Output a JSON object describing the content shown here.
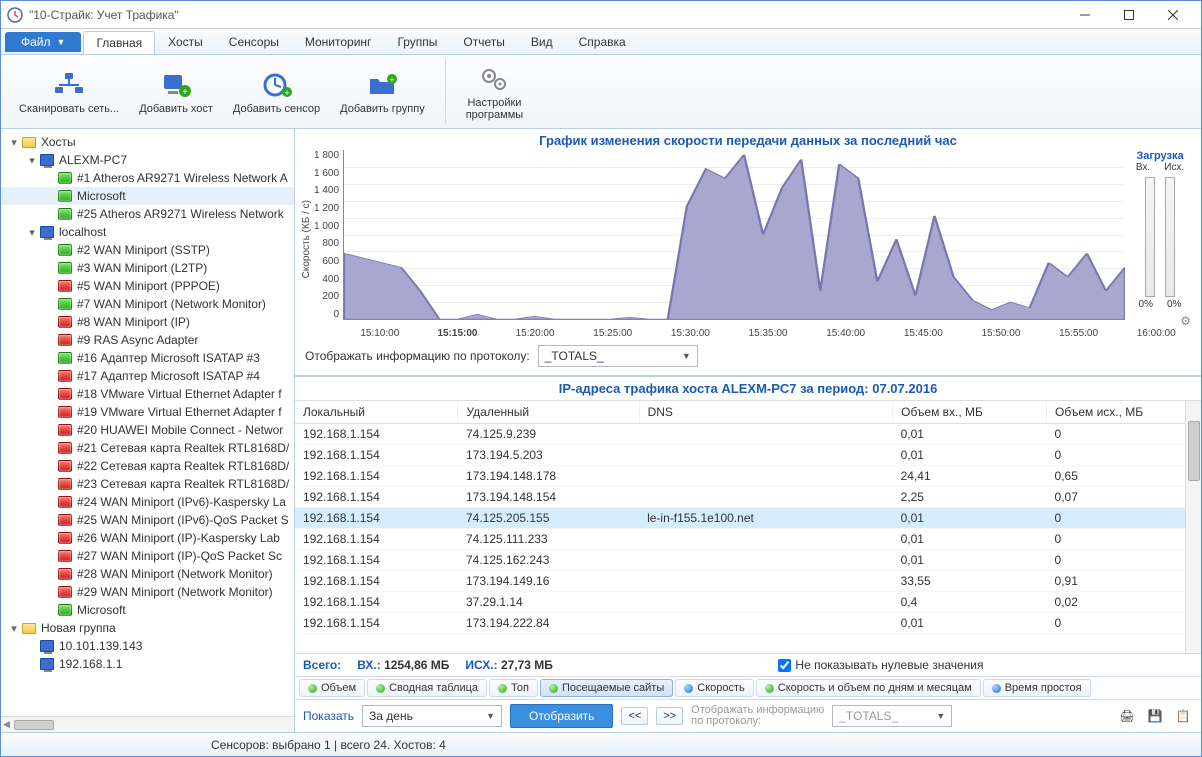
{
  "window": {
    "title": "\"10-Страйк: Учет Трафика\""
  },
  "menubar": {
    "file": "Файл",
    "tabs": [
      "Главная",
      "Хосты",
      "Сенсоры",
      "Мониторинг",
      "Группы",
      "Отчеты",
      "Вид",
      "Справка"
    ],
    "active": 0
  },
  "ribbon": {
    "g1": [
      {
        "label": "Сканировать сеть...",
        "icon": "scan-network-icon"
      },
      {
        "label": "Добавить хост",
        "icon": "add-host-icon"
      },
      {
        "label": "Добавить сенсор",
        "icon": "add-sensor-icon"
      },
      {
        "label": "Добавить группу",
        "icon": "add-group-icon"
      }
    ],
    "g2": [
      {
        "label": "Настройки\nпрограммы",
        "icon": "settings-icon"
      }
    ]
  },
  "tree": [
    {
      "d": 0,
      "exp": "▾",
      "icon": "folder",
      "label": "Хосты"
    },
    {
      "d": 1,
      "exp": "▾",
      "icon": "pc",
      "label": "ALEXM-PC7"
    },
    {
      "d": 2,
      "icon": "g",
      "label": "#1 Atheros AR9271 Wireless Network A"
    },
    {
      "d": 2,
      "icon": "g",
      "label": "Microsoft",
      "sel": true
    },
    {
      "d": 2,
      "icon": "g",
      "label": "#25 Atheros AR9271 Wireless Network"
    },
    {
      "d": 1,
      "exp": "▾",
      "icon": "pc",
      "label": "localhost"
    },
    {
      "d": 2,
      "icon": "g",
      "label": "#2 WAN Miniport (SSTP)"
    },
    {
      "d": 2,
      "icon": "g",
      "label": "#3 WAN Miniport (L2TP)"
    },
    {
      "d": 2,
      "icon": "r",
      "label": "#5 WAN Miniport (PPPOE)"
    },
    {
      "d": 2,
      "icon": "g",
      "label": "#7 WAN Miniport (Network Monitor)"
    },
    {
      "d": 2,
      "icon": "r",
      "label": "#8 WAN Miniport (IP)"
    },
    {
      "d": 2,
      "icon": "r",
      "label": "#9 RAS Async Adapter"
    },
    {
      "d": 2,
      "icon": "g",
      "label": "#16 Адаптер Microsoft ISATAP #3"
    },
    {
      "d": 2,
      "icon": "r",
      "label": "#17 Адаптер Microsoft ISATAP #4"
    },
    {
      "d": 2,
      "icon": "r",
      "label": "#18 VMware Virtual Ethernet Adapter f"
    },
    {
      "d": 2,
      "icon": "r",
      "label": "#19 VMware Virtual Ethernet Adapter f"
    },
    {
      "d": 2,
      "icon": "r",
      "label": "#20 HUAWEI Mobile Connect - Networ"
    },
    {
      "d": 2,
      "icon": "r",
      "label": "#21 Сетевая карта Realtek RTL8168D/"
    },
    {
      "d": 2,
      "icon": "r",
      "label": "#22 Сетевая карта Realtek RTL8168D/"
    },
    {
      "d": 2,
      "icon": "r",
      "label": "#23 Сетевая карта Realtek RTL8168D/"
    },
    {
      "d": 2,
      "icon": "r",
      "label": "#24 WAN Miniport (IPv6)-Kaspersky La"
    },
    {
      "d": 2,
      "icon": "r",
      "label": "#25 WAN Miniport (IPv6)-QoS Packet S"
    },
    {
      "d": 2,
      "icon": "r",
      "label": "#26 WAN Miniport (IP)-Kaspersky Lab"
    },
    {
      "d": 2,
      "icon": "r",
      "label": "#27 WAN Miniport (IP)-QoS Packet Sc"
    },
    {
      "d": 2,
      "icon": "r",
      "label": "#28 WAN Miniport (Network Monitor)"
    },
    {
      "d": 2,
      "icon": "r",
      "label": "#29 WAN Miniport (Network Monitor)"
    },
    {
      "d": 2,
      "icon": "g",
      "label": "Microsoft"
    },
    {
      "d": 0,
      "exp": "▾",
      "icon": "folder",
      "label": "Новая группа"
    },
    {
      "d": 1,
      "icon": "pc",
      "label": "10.101.139.143"
    },
    {
      "d": 1,
      "icon": "pc",
      "label": "192.168.1.1"
    }
  ],
  "chart": {
    "title": "График изменения скорости передачи данных за последний час",
    "ylabel": "Скорость (КБ / с)",
    "yticks": [
      "1 800",
      "1 600",
      "1 400",
      "1 200",
      "1 000",
      "800",
      "600",
      "400",
      "200",
      "0"
    ],
    "xticks": [
      "15:10:00",
      "15:15:00",
      "15:20:00",
      "15:25:00",
      "15:30:00",
      "15:35:00",
      "15:40:00",
      "15:45:00",
      "15:50:00",
      "15:55:00",
      "16:00:00"
    ],
    "xhighlight": 1,
    "load_title": "Загрузка",
    "load_in": "Вх.",
    "load_out": "Исх.",
    "pct": "0%"
  },
  "chart_data": {
    "type": "area",
    "ylim": [
      0,
      1800
    ],
    "x": [
      "15:06",
      "15:08",
      "15:10",
      "15:12",
      "15:14",
      "15:16",
      "15:18",
      "15:20",
      "15:22",
      "15:24",
      "15:26",
      "15:28",
      "15:30",
      "15:32",
      "15:34",
      "15:36",
      "15:38",
      "15:40",
      "15:41",
      "15:42",
      "15:43",
      "15:44",
      "15:45",
      "15:46",
      "15:47",
      "15:48",
      "15:49",
      "15:50",
      "15:51",
      "15:52",
      "15:53",
      "15:54",
      "15:55",
      "15:56",
      "15:57",
      "15:58",
      "15:59",
      "16:00",
      "16:01",
      "16:02",
      "16:03",
      "16:04"
    ],
    "series": [
      {
        "name": "Вх.",
        "values": [
          700,
          650,
          600,
          550,
          300,
          0,
          0,
          50,
          0,
          0,
          30,
          0,
          0,
          0,
          0,
          20,
          0,
          0,
          1200,
          1600,
          1500,
          1750,
          900,
          1400,
          1700,
          300,
          1650,
          1500,
          400,
          850,
          250,
          1100,
          450,
          200,
          100,
          180,
          120,
          600,
          450,
          700,
          300,
          550
        ]
      }
    ]
  },
  "protobar": {
    "label": "Отображать информацию по протоколу:",
    "value": "_TOTALS_"
  },
  "table": {
    "title": "IP-адреса трафика хоста ALEXM-PC7 за период: 07.07.2016",
    "cols": [
      "Локальный",
      "Удаленный",
      "DNS",
      "Объем вх., МБ",
      "Объем исх., МБ"
    ],
    "rows": [
      [
        "192.168.1.154",
        "74.125.9.239",
        "",
        "0,01",
        "0"
      ],
      [
        "192.168.1.154",
        "173.194.5.203",
        "",
        "0,01",
        "0"
      ],
      [
        "192.168.1.154",
        "173.194.148.178",
        "",
        "24,41",
        "0,65"
      ],
      [
        "192.168.1.154",
        "173.194.148.154",
        "",
        "2,25",
        "0,07"
      ],
      [
        "192.168.1.154",
        "74.125.205.155",
        "le-in-f155.1e100.net",
        "0,01",
        "0"
      ],
      [
        "192.168.1.154",
        "74.125.111.233",
        "",
        "0,01",
        "0"
      ],
      [
        "192.168.1.154",
        "74.125.162.243",
        "",
        "0,01",
        "0"
      ],
      [
        "192.168.1.154",
        "173.194.149.16",
        "",
        "33,55",
        "0,91"
      ],
      [
        "192.168.1.154",
        "37.29.1.14",
        "",
        "0,4",
        "0,02"
      ],
      [
        "192.168.1.154",
        "173.194.222.84",
        "",
        "0,01",
        "0"
      ]
    ],
    "selrow": 4
  },
  "totals": {
    "label_all": "Всего:",
    "label_in": "ВХ.:",
    "val_in": "1254,86 МБ",
    "label_out": "ИСХ.:",
    "val_out": "27,73 МБ",
    "hide_zero": "Не показывать нулевые значения",
    "hide_zero_checked": true
  },
  "bottomtabs": [
    {
      "dot": "g",
      "label": "Объем"
    },
    {
      "dot": "g",
      "label": "Сводная таблица"
    },
    {
      "dot": "g",
      "label": "Топ"
    },
    {
      "dot": "g",
      "label": "Посещаемые сайты",
      "active": true
    },
    {
      "dot": "b",
      "label": "Скорость"
    },
    {
      "dot": "g",
      "label": "Скорость и объем по дням и месяцам"
    },
    {
      "dot": "b",
      "label": "Время простоя"
    }
  ],
  "filterbar": {
    "show": "Показать",
    "period": "За день",
    "display": "Отобразить",
    "prev": "<<",
    "next": ">>",
    "proto_label": "Отображать информацию\nпо протоколу:",
    "proto_value": "_TOTALS_"
  },
  "statusbar": {
    "text": "Сенсоров: выбрано 1 | всего 24. Хостов: 4"
  }
}
